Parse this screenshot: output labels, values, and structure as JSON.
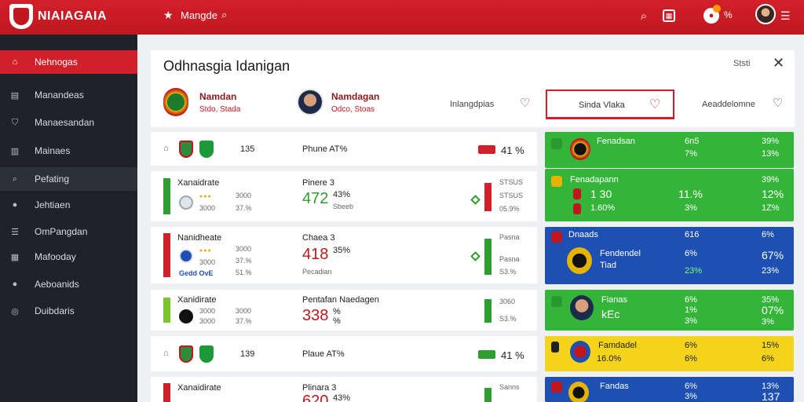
{
  "app": {
    "title": "NIAIAGAIA"
  },
  "topnav": {
    "label": "Mangde",
    "count": "%"
  },
  "sidebar": {
    "items": [
      {
        "label": "Nehnogas"
      },
      {
        "label": "Manandeas"
      },
      {
        "label": "Manaesandan"
      },
      {
        "label": "Mainaes"
      },
      {
        "label": "Pefating"
      },
      {
        "label": "Jehtiaen"
      },
      {
        "label": "OmPangdan"
      },
      {
        "label": "Mafooday"
      },
      {
        "label": "Aeboanids"
      },
      {
        "label": "Duibdaris"
      }
    ]
  },
  "panel": {
    "title": "Odhnasgia Idanigan",
    "meta": "Ststi",
    "team1": {
      "name": "Namdan",
      "sub": "Stdo, Stada"
    },
    "team2": {
      "name": "Namdagan",
      "sub": "Odco, Stoas"
    },
    "tab1": "Inlangdpias",
    "tab_active": "Sinda Vlaka",
    "tab3": "Aeaddelomne"
  },
  "cards": [
    {
      "left_num": "135",
      "mid": "Phune AT%",
      "pill": "TIIA",
      "pct": "41 %"
    },
    {
      "title": "Xanaidrate",
      "a": "3000",
      "b": "37.%",
      "mid_title": "Pinere 3",
      "big": "472",
      "pct": "43%",
      "sub": "Sbeeb",
      "r1": "STSUS",
      "r2": "05.9%"
    },
    {
      "title": "Nanidheate",
      "a": "3000",
      "b": "37.%",
      "c": "Gedd OvE",
      "d": "51.%",
      "mid_title": "Chaea 3",
      "big": "418",
      "pct": "35%",
      "sub": "Pecadian",
      "r1": "Pasna",
      "r2": "S3.%"
    },
    {
      "title": "Xanidirate",
      "a": "3000",
      "b": "37.%",
      "mid_title": "Pentafan Naedagen",
      "big": "338",
      "pct": "%",
      "sub": "%",
      "r1": "3060",
      "r2": "S3.%"
    },
    {
      "left_num": "139",
      "mid": "Plaue AT%",
      "pill": "IIIA",
      "pct": "41 %"
    },
    {
      "title": "Xanaidirate",
      "mid_title": "Plinara 3",
      "big": "620",
      "pct": "43%",
      "r1": "Sanns"
    }
  ],
  "tiles": [
    {
      "name": "Fenadsan",
      "c1": "6n5",
      "c2": "39%",
      "v1": "7%",
      "v2": "13%"
    },
    {
      "name": "Fenadapann",
      "big": "1 30",
      "c1": "11.%",
      "c2": "12%",
      "sub": "1.60%",
      "v1": "3%",
      "v2": "1Z%"
    },
    {
      "name": "Dnaads",
      "c1": "616",
      "c2": "6%",
      "title": "Fendendel",
      "sub": "Tiad",
      "v1": "6%",
      "big2": "67%",
      "v2": "23%"
    },
    {
      "name": "Fianas",
      "big": "kEc",
      "c1": "6%",
      "c2": "35%",
      "v1": "1%",
      "v2": "07%",
      "v3": "3%"
    },
    {
      "name": "Famdadel",
      "c1": "6%",
      "c2": "15%",
      "sub": "16.0%",
      "v1": "6%",
      "v2": "6%"
    },
    {
      "name": "Fandas",
      "c1": "6%",
      "c2": "13%",
      "v1": "3%",
      "v2": "137"
    }
  ],
  "colors": {
    "brand_red": "#d2202a",
    "sidebar": "#1f2329",
    "tile_green": "#34b53a",
    "tile_blue": "#1e4fb3",
    "tile_yellow": "#f4d31b"
  }
}
